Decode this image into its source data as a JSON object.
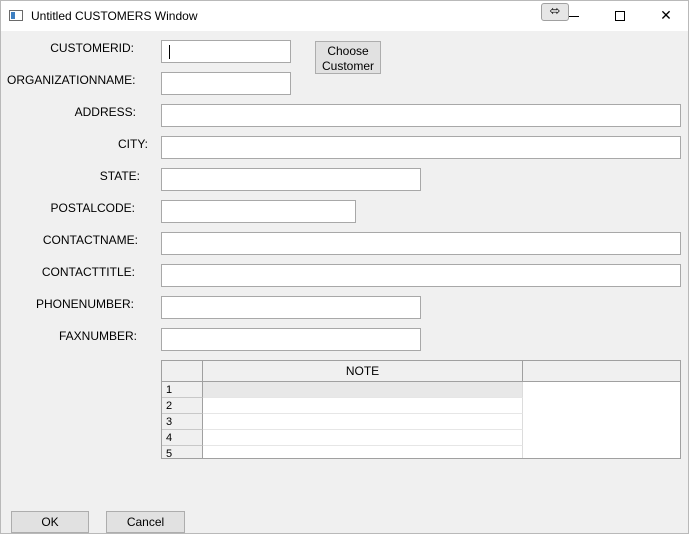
{
  "window": {
    "title": "Untitled CUSTOMERS Window",
    "snap_glyph": "⬄",
    "close_glyph": "✕"
  },
  "form": {
    "customerid_label": "CUSTOMERID:",
    "customerid_value": "",
    "choose_customer_line1": "Choose",
    "choose_customer_line2": "Customer",
    "organizationname_label": "ORGANIZATIONNAME:",
    "organizationname_value": "",
    "address_label": "ADDRESS:",
    "address_value": "",
    "city_label": "CITY:",
    "city_value": "",
    "state_label": "STATE:",
    "state_value": "",
    "postalcode_label": "POSTALCODE:",
    "postalcode_value": "",
    "contactname_label": "CONTACTNAME:",
    "contactname_value": "",
    "contacttitle_label": "CONTACTTITLE:",
    "contacttitle_value": "",
    "phonenumber_label": "PHONENUMBER:",
    "phonenumber_value": "",
    "faxnumber_label": "FAXNUMBER:",
    "faxnumber_value": ""
  },
  "grid": {
    "column_header": "NOTE",
    "rows": [
      {
        "num": "1",
        "note": ""
      },
      {
        "num": "2",
        "note": ""
      },
      {
        "num": "3",
        "note": ""
      },
      {
        "num": "4",
        "note": ""
      },
      {
        "num": "5",
        "note": ""
      }
    ]
  },
  "buttons": {
    "ok_label": "OK",
    "cancel_label": "Cancel"
  }
}
